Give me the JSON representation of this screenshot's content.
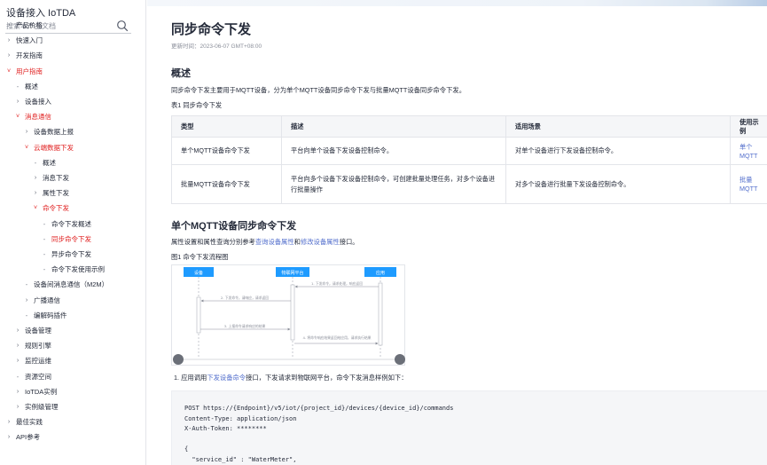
{
  "sidebar": {
    "title": "设备接入 IoTDA",
    "search_placeholder": "搜索本产品文档",
    "items": [
      {
        "label": "产品价格",
        "level": 0,
        "icon": "chevron-right",
        "active": false
      },
      {
        "label": "快速入门",
        "level": 0,
        "icon": "chevron-right",
        "active": false
      },
      {
        "label": "开发指南",
        "level": 0,
        "icon": "chevron-right",
        "active": false
      },
      {
        "label": "用户指南",
        "level": 0,
        "icon": "chevron-down",
        "active": true
      },
      {
        "label": "概述",
        "level": 1,
        "icon": "dash",
        "active": false
      },
      {
        "label": "设备接入",
        "level": 1,
        "icon": "chevron-right",
        "active": false
      },
      {
        "label": "消息通信",
        "level": 1,
        "icon": "chevron-down",
        "active": true
      },
      {
        "label": "设备数据上报",
        "level": 2,
        "icon": "chevron-right",
        "active": false
      },
      {
        "label": "云端数据下发",
        "level": 2,
        "icon": "chevron-down",
        "active": true
      },
      {
        "label": "概述",
        "level": 3,
        "icon": "dash",
        "active": false
      },
      {
        "label": "消息下发",
        "level": 3,
        "icon": "chevron-right",
        "active": false
      },
      {
        "label": "属性下发",
        "level": 3,
        "icon": "chevron-right",
        "active": false
      },
      {
        "label": "命令下发",
        "level": 3,
        "icon": "chevron-down",
        "active": true
      },
      {
        "label": "命令下发概述",
        "level": 4,
        "icon": "dash",
        "active": false
      },
      {
        "label": "同步命令下发",
        "level": 4,
        "icon": "dash",
        "active": true
      },
      {
        "label": "异步命令下发",
        "level": 4,
        "icon": "dash",
        "active": false
      },
      {
        "label": "命令下发使用示例",
        "level": 4,
        "icon": "dash",
        "active": false
      },
      {
        "label": "设备间消息通信（M2M）",
        "level": 2,
        "icon": "dash",
        "active": false
      },
      {
        "label": "广播通信",
        "level": 2,
        "icon": "chevron-right",
        "active": false
      },
      {
        "label": "编解码插件",
        "level": 2,
        "icon": "dash",
        "active": false
      },
      {
        "label": "设备管理",
        "level": 1,
        "icon": "chevron-right",
        "active": false
      },
      {
        "label": "规则引擎",
        "level": 1,
        "icon": "chevron-right",
        "active": false
      },
      {
        "label": "监控运维",
        "level": 1,
        "icon": "chevron-right",
        "active": false
      },
      {
        "label": "资源空间",
        "level": 1,
        "icon": "dash",
        "active": false
      },
      {
        "label": "IoTDA实例",
        "level": 1,
        "icon": "chevron-right",
        "active": false
      },
      {
        "label": "实例级管理",
        "level": 1,
        "icon": "chevron-right",
        "active": false
      },
      {
        "label": "最佳实践",
        "level": 0,
        "icon": "chevron-right",
        "active": false
      },
      {
        "label": "API参考",
        "level": 0,
        "icon": "chevron-right",
        "active": false
      }
    ]
  },
  "main": {
    "title": "同步命令下发",
    "update_time": "更新时间：2023-06-07 GMT+08:00",
    "overview_heading": "概述",
    "overview_text": "同步命令下发主要用于MQTT设备，分为单个MQTT设备同步命令下发与批量MQTT设备同步命令下发。",
    "table_caption": "表1 同步命令下发",
    "table": {
      "headers": [
        "类型",
        "描述",
        "适用场景",
        "使用示例"
      ],
      "rows": [
        [
          "单个MQTT设备命令下发",
          "平台向单个设备下发设备控制命令。",
          "对单个设备进行下发设备控制命令。",
          "单个MQTT"
        ],
        [
          "批量MQTT设备命令下发",
          "平台向多个设备下发设备控制命令，可创建批量处理任务，对多个设备进行批量操作",
          "对多个设备进行批量下发设备控制命令。",
          "批量MQTT"
        ]
      ]
    },
    "single_heading": "单个MQTT设备同步命令下发",
    "single_text_a": "属性设置和属性查询分别参考",
    "single_link_a": "查询设备属性",
    "single_text_b": "和",
    "single_link_b": "修改设备属性",
    "single_text_c": "接口。",
    "figure_caption": "图1 命令下发流程图",
    "figure": {
      "actors": [
        "设备",
        "物联网平台",
        "应用"
      ],
      "messages": [
        "1. 下发命令，请求处理，响应返回",
        "2. 下发命令，请响应，请求返回",
        "3. 上报命令请求响应的结果",
        "4. 将命令响应结果返回给应用，请求执行结果"
      ]
    },
    "step1_prefix": "1. 应用调用",
    "step1_link": "下发设备命令",
    "step1_suffix": "接口，下发请求到物联网平台，命令下发消息样例如下：",
    "code_lines": [
      "POST https://{Endpoint}/v5/iot/{project_id}/devices/{device_id}/commands",
      "Content-Type: application/json",
      "X-Auth-Token: ********",
      "",
      "{",
      "  \"service_id\" : \"WaterMeter\","
    ]
  },
  "colors": {
    "accent_red": "#e02020",
    "link_blue": "#526ecc",
    "actor_blue": "#1e9bff"
  }
}
